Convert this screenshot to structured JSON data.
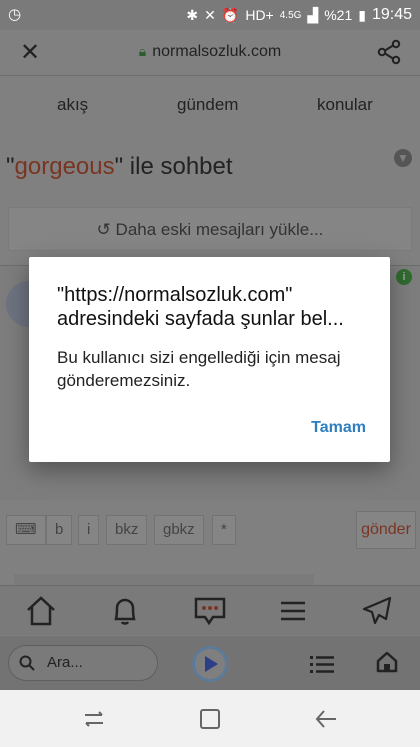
{
  "status_bar": {
    "network": "HD+",
    "network_type": "4.5G",
    "battery": "%21",
    "time": "19:45"
  },
  "url_bar": {
    "url": "normalsozluk.com"
  },
  "tabs": [
    "akış",
    "gündem",
    "konular"
  ],
  "conversation": {
    "title_prefix": "\"",
    "username": "gorgeous",
    "title_suffix": "\" ile sohbet",
    "load_older": "Daha eski mesajları yükle..."
  },
  "format_bar": {
    "bold": "b",
    "italic": "i",
    "bkz": "bkz",
    "gbkz": "gbkz",
    "star": "*",
    "send": "gönder"
  },
  "browser_bar": {
    "search_placeholder": "Ara..."
  },
  "dialog": {
    "title": "\"https://normalsozluk.com\" adresindeki sayfada şunlar bel...",
    "message": "Bu kullanıcı sizi engellediği için mesaj gönderemezsiniz.",
    "ok": "Tamam"
  },
  "colors": {
    "accent_link": "#2f7fc0",
    "username": "#7a3522"
  }
}
